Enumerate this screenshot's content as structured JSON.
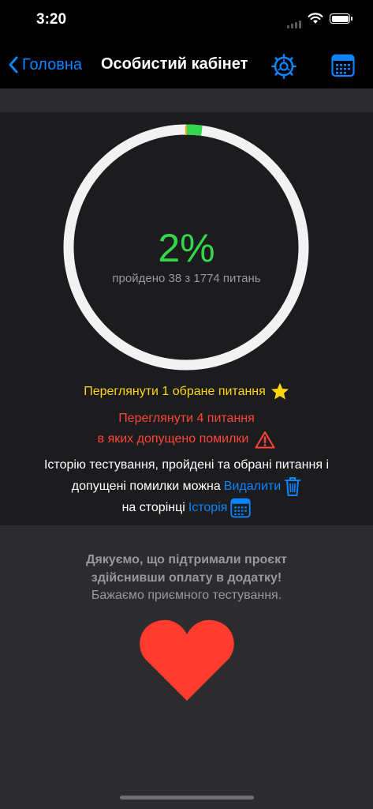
{
  "status_bar": {
    "time": "3:20"
  },
  "nav": {
    "back_label": "Головна",
    "title": "Особистий кабінет"
  },
  "progress": {
    "percent_label": "2%",
    "subtitle": "пройдено 38 з 1774 питань",
    "completed": 38,
    "total": 1774,
    "ring_color": "#32d74b",
    "track_color": "#f2f2f2"
  },
  "favorites": {
    "text": "Переглянути 1 обране питання"
  },
  "mistakes": {
    "line1": "Переглянути 4 питання",
    "line2": "в яких допущено помилки"
  },
  "info": {
    "line1": "Історію тестування, пройдені та обрані питання і",
    "line2_prefix": "допущені помилки можна",
    "delete_link": "Видалити",
    "line3_prefix": "на сторінці",
    "history_link": "Історія"
  },
  "support": {
    "thanks_line1": "Дякуємо, що підтримали проєкт",
    "thanks_line2": "здійснивши оплату в додатку!",
    "wish": "Бажаємо приємного тестування."
  },
  "colors": {
    "accent": "#0a84ff",
    "success": "#32d74b",
    "warning": "#ffd60a",
    "danger": "#ff453a",
    "heart": "#ff3b30"
  },
  "icons": [
    "chevron-left-icon",
    "gear-icon",
    "calendar-icon",
    "star-icon",
    "warning-icon",
    "trash-icon",
    "heart-icon"
  ]
}
